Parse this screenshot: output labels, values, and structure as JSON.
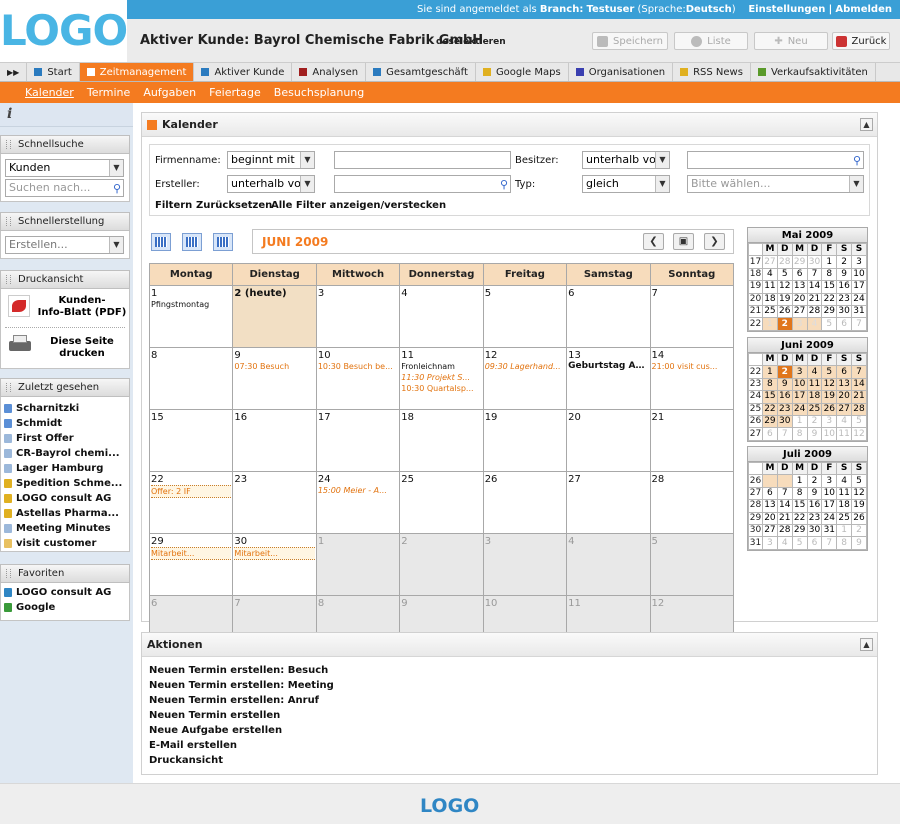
{
  "header": {
    "logo_text": "LOGO",
    "login_prefix": "Sie sind angemeldet als",
    "branch_label": "Branch:",
    "user": "Testuser",
    "lang_prefix": "(Sprache:",
    "lang": "Deutsch",
    "lang_suffix": ")",
    "settings": "Einstellungen",
    "separator": "|",
    "logout": "Abmelden",
    "customer_title": "Aktiver Kunde: Bayrol Chemische Fabrik GmbH",
    "deselect": "deselektieren",
    "buttons": {
      "save": "Speichern",
      "list": "Liste",
      "new": "Neu",
      "back": "Zurück"
    }
  },
  "nav": {
    "expand": "▶▶",
    "items": [
      {
        "label": "Start",
        "color": "#2b7bbf"
      },
      {
        "label": "Zeitmanagement",
        "color": "#ffffff"
      },
      {
        "label": "Aktiver Kunde",
        "color": "#2b7bbf"
      },
      {
        "label": "Analysen",
        "color": "#a01e1e"
      },
      {
        "label": "Gesamtgeschäft",
        "color": "#2b7bbf"
      },
      {
        "label": "Google Maps",
        "color": "#e0b020"
      },
      {
        "label": "Organisationen",
        "color": "#3a3fb0"
      },
      {
        "label": "RSS News",
        "color": "#e0b020"
      },
      {
        "label": "Verkaufsaktivitäten",
        "color": "#5a9a2a"
      }
    ],
    "active_index": 1
  },
  "subnav": [
    "Kalender",
    "Termine",
    "Aufgaben",
    "Feiertage",
    "Besuchsplanung"
  ],
  "sidebar": {
    "info_icon": "i",
    "quicksearch": {
      "title": "Schnellsuche",
      "select_value": "Kunden",
      "placeholder": "Suchen nach..."
    },
    "quickcreate": {
      "title": "Schnellerstellung",
      "select_value": "Erstellen..."
    },
    "print": {
      "title": "Druckansicht",
      "pdf_label_1": "Kunden-",
      "pdf_label_2": "Info-Blatt (PDF)",
      "print_label_1": "Diese Seite",
      "print_label_2": "drucken"
    },
    "recent": {
      "title": "Zuletzt gesehen",
      "items": [
        {
          "label": "Scharnitzki",
          "color": "#5b8fd6"
        },
        {
          "label": "Schmidt",
          "color": "#5b8fd6"
        },
        {
          "label": "First Offer",
          "color": "#9cb8da"
        },
        {
          "label": "CR-Bayrol chemi...",
          "color": "#9cb8da"
        },
        {
          "label": "Lager Hamburg",
          "color": "#9cb8da"
        },
        {
          "label": "Spedition Schme...",
          "color": "#e0b020"
        },
        {
          "label": "LOGO consult AG",
          "color": "#e0b020"
        },
        {
          "label": "Astellas Pharma...",
          "color": "#e0b020"
        },
        {
          "label": "Meeting Minutes",
          "color": "#9cb8da"
        },
        {
          "label": "visit customer",
          "color": "#e8c060"
        }
      ]
    },
    "favorites": {
      "title": "Favoriten",
      "items": [
        {
          "label": "LOGO consult AG",
          "color": "#2f86c4"
        },
        {
          "label": "Google",
          "color": "#3a9a3a"
        }
      ]
    }
  },
  "calendar_panel": {
    "title": "Kalender",
    "filters": {
      "firmenname_label": "Firmenname:",
      "firmenname_op": "beginnt mit",
      "besitzer_label": "Besitzer:",
      "besitzer_op": "unterhalb vor",
      "ersteller_label": "Ersteller:",
      "ersteller_op": "unterhalb vor",
      "typ_label": "Typ:",
      "typ_op": "gleich",
      "typ_placeholder": "Bitte wählen...",
      "filter_link": "Filtern",
      "reset_link": "Zurücksetzen",
      "toggle_link": "Alle Filter anzeigen/verstecken"
    },
    "month_title": "JUNI 2009",
    "weekdays": [
      "Montag",
      "Dienstag",
      "Mittwoch",
      "Donnerstag",
      "Freitag",
      "Samstag",
      "Sonntag"
    ],
    "weeks": [
      [
        {
          "d": "1",
          "events": [
            {
              "t": "Pfingstmontag",
              "c": "bl"
            }
          ]
        },
        {
          "d": "2 (heute)",
          "today": true,
          "events": []
        },
        {
          "d": "3",
          "events": []
        },
        {
          "d": "4",
          "events": []
        },
        {
          "d": "5",
          "events": []
        },
        {
          "d": "6",
          "events": []
        },
        {
          "d": "7",
          "events": []
        }
      ],
      [
        {
          "d": "8",
          "events": []
        },
        {
          "d": "9",
          "events": [
            {
              "t": "07:30 Besuch",
              "c": ""
            }
          ]
        },
        {
          "d": "10",
          "events": [
            {
              "t": "10:30 Besuch be...",
              "c": ""
            }
          ]
        },
        {
          "d": "11",
          "events": [
            {
              "t": "Fronleichnam",
              "c": "bl"
            },
            {
              "t": "11:30 Projekt S...",
              "c": "it"
            },
            {
              "t": "10:30 Quartalsp...",
              "c": ""
            }
          ]
        },
        {
          "d": "12",
          "events": [
            {
              "t": "09:30 Lagerhand...",
              "c": "it"
            }
          ]
        },
        {
          "d": "13",
          "events": [
            {
              "t": "Geburtstag AM...",
              "c": "bold"
            }
          ]
        },
        {
          "d": "14",
          "events": [
            {
              "t": "21:00 visit cus...",
              "c": ""
            }
          ]
        }
      ],
      [
        {
          "d": "15",
          "events": []
        },
        {
          "d": "16",
          "events": []
        },
        {
          "d": "17",
          "events": []
        },
        {
          "d": "18",
          "events": []
        },
        {
          "d": "19",
          "events": []
        },
        {
          "d": "20",
          "events": []
        },
        {
          "d": "21",
          "events": []
        }
      ],
      [
        {
          "d": "22",
          "events": [
            {
              "t": "Offer: 2 IF",
              "c": "dot"
            }
          ]
        },
        {
          "d": "23",
          "events": []
        },
        {
          "d": "24",
          "events": [
            {
              "t": "15:00 Meier - A...",
              "c": "it"
            }
          ]
        },
        {
          "d": "25",
          "events": []
        },
        {
          "d": "26",
          "events": []
        },
        {
          "d": "27",
          "events": []
        },
        {
          "d": "28",
          "events": []
        }
      ],
      [
        {
          "d": "29",
          "events": [
            {
              "t": "Mitarbeit...",
              "c": "dot"
            }
          ]
        },
        {
          "d": "30",
          "events": [
            {
              "t": "Mitarbeit...",
              "c": "dot"
            }
          ]
        },
        {
          "d": "1",
          "other": true,
          "events": []
        },
        {
          "d": "2",
          "other": true,
          "events": []
        },
        {
          "d": "3",
          "other": true,
          "events": []
        },
        {
          "d": "4",
          "other": true,
          "events": []
        },
        {
          "d": "5",
          "other": true,
          "events": []
        }
      ],
      [
        {
          "d": "6",
          "other": true,
          "events": []
        },
        {
          "d": "7",
          "other": true,
          "events": []
        },
        {
          "d": "8",
          "other": true,
          "events": []
        },
        {
          "d": "9",
          "other": true,
          "events": []
        },
        {
          "d": "10",
          "other": true,
          "events": []
        },
        {
          "d": "11",
          "other": true,
          "events": []
        },
        {
          "d": "12",
          "other": true,
          "events": []
        }
      ]
    ]
  },
  "mini_calendars": [
    {
      "title": "Mai 2009",
      "head": [
        "",
        "M",
        "D",
        "M",
        "D",
        "F",
        "S",
        "S"
      ],
      "rows": [
        [
          {
            "v": "17",
            "k": "wk"
          },
          {
            "v": "27",
            "k": "oth"
          },
          {
            "v": "28",
            "k": "oth"
          },
          {
            "v": "29",
            "k": "oth"
          },
          {
            "v": "30",
            "k": "oth"
          },
          {
            "v": "1",
            "k": ""
          },
          {
            "v": "2",
            "k": ""
          },
          {
            "v": "3",
            "k": ""
          }
        ],
        [
          {
            "v": "18",
            "k": "wk"
          },
          {
            "v": "4",
            "k": ""
          },
          {
            "v": "5",
            "k": ""
          },
          {
            "v": "6",
            "k": ""
          },
          {
            "v": "7",
            "k": ""
          },
          {
            "v": "8",
            "k": ""
          },
          {
            "v": "9",
            "k": ""
          },
          {
            "v": "10",
            "k": ""
          }
        ],
        [
          {
            "v": "19",
            "k": "wk"
          },
          {
            "v": "11",
            "k": ""
          },
          {
            "v": "12",
            "k": ""
          },
          {
            "v": "13",
            "k": ""
          },
          {
            "v": "14",
            "k": ""
          },
          {
            "v": "15",
            "k": ""
          },
          {
            "v": "16",
            "k": ""
          },
          {
            "v": "17",
            "k": ""
          }
        ],
        [
          {
            "v": "20",
            "k": "wk"
          },
          {
            "v": "18",
            "k": ""
          },
          {
            "v": "19",
            "k": ""
          },
          {
            "v": "20",
            "k": ""
          },
          {
            "v": "21",
            "k": ""
          },
          {
            "v": "22",
            "k": ""
          },
          {
            "v": "23",
            "k": ""
          },
          {
            "v": "24",
            "k": ""
          }
        ],
        [
          {
            "v": "21",
            "k": "wk"
          },
          {
            "v": "25",
            "k": ""
          },
          {
            "v": "26",
            "k": ""
          },
          {
            "v": "27",
            "k": ""
          },
          {
            "v": "28",
            "k": ""
          },
          {
            "v": "29",
            "k": ""
          },
          {
            "v": "30",
            "k": ""
          },
          {
            "v": "31",
            "k": ""
          }
        ],
        [
          {
            "v": "22",
            "k": "wk"
          },
          {
            "v": "1",
            "k": "hl"
          },
          {
            "v": "2",
            "k": "tdy"
          },
          {
            "v": "3",
            "k": "hl"
          },
          {
            "v": "4",
            "k": "hl"
          },
          {
            "v": "5",
            "k": "oth"
          },
          {
            "v": "6",
            "k": "oth"
          },
          {
            "v": "7",
            "k": "oth"
          }
        ]
      ]
    },
    {
      "title": "Juni 2009",
      "head": [
        "",
        "M",
        "D",
        "M",
        "D",
        "F",
        "S",
        "S"
      ],
      "rows": [
        [
          {
            "v": "22",
            "k": "wk"
          },
          {
            "v": "1",
            "k": "cur"
          },
          {
            "v": "2",
            "k": "tdy"
          },
          {
            "v": "3",
            "k": "cur"
          },
          {
            "v": "4",
            "k": "cur"
          },
          {
            "v": "5",
            "k": "cur"
          },
          {
            "v": "6",
            "k": "cur"
          },
          {
            "v": "7",
            "k": "cur"
          }
        ],
        [
          {
            "v": "23",
            "k": "wk"
          },
          {
            "v": "8",
            "k": "cur"
          },
          {
            "v": "9",
            "k": "cur"
          },
          {
            "v": "10",
            "k": "cur"
          },
          {
            "v": "11",
            "k": "cur"
          },
          {
            "v": "12",
            "k": "cur"
          },
          {
            "v": "13",
            "k": "cur"
          },
          {
            "v": "14",
            "k": "cur"
          }
        ],
        [
          {
            "v": "24",
            "k": "wk"
          },
          {
            "v": "15",
            "k": "cur"
          },
          {
            "v": "16",
            "k": "cur"
          },
          {
            "v": "17",
            "k": "cur"
          },
          {
            "v": "18",
            "k": "cur"
          },
          {
            "v": "19",
            "k": "cur"
          },
          {
            "v": "20",
            "k": "cur"
          },
          {
            "v": "21",
            "k": "cur"
          }
        ],
        [
          {
            "v": "25",
            "k": "wk"
          },
          {
            "v": "22",
            "k": "cur"
          },
          {
            "v": "23",
            "k": "cur"
          },
          {
            "v": "24",
            "k": "cur"
          },
          {
            "v": "25",
            "k": "cur"
          },
          {
            "v": "26",
            "k": "cur"
          },
          {
            "v": "27",
            "k": "cur"
          },
          {
            "v": "28",
            "k": "cur"
          }
        ],
        [
          {
            "v": "26",
            "k": "wk"
          },
          {
            "v": "29",
            "k": "cur"
          },
          {
            "v": "30",
            "k": "cur"
          },
          {
            "v": "1",
            "k": "oth"
          },
          {
            "v": "2",
            "k": "oth"
          },
          {
            "v": "3",
            "k": "oth"
          },
          {
            "v": "4",
            "k": "oth"
          },
          {
            "v": "5",
            "k": "oth"
          }
        ],
        [
          {
            "v": "27",
            "k": "wk"
          },
          {
            "v": "6",
            "k": "oth"
          },
          {
            "v": "7",
            "k": "oth"
          },
          {
            "v": "8",
            "k": "oth"
          },
          {
            "v": "9",
            "k": "oth"
          },
          {
            "v": "10",
            "k": "oth"
          },
          {
            "v": "11",
            "k": "oth"
          },
          {
            "v": "12",
            "k": "oth"
          }
        ]
      ]
    },
    {
      "title": "Juli 2009",
      "head": [
        "",
        "M",
        "D",
        "M",
        "D",
        "F",
        "S",
        "S"
      ],
      "rows": [
        [
          {
            "v": "26",
            "k": "wk"
          },
          {
            "v": "",
            "k": "hl"
          },
          {
            "v": "",
            "k": "hl"
          },
          {
            "v": "1",
            "k": ""
          },
          {
            "v": "2",
            "k": ""
          },
          {
            "v": "3",
            "k": ""
          },
          {
            "v": "4",
            "k": ""
          },
          {
            "v": "5",
            "k": ""
          }
        ],
        [
          {
            "v": "27",
            "k": "wk"
          },
          {
            "v": "6",
            "k": ""
          },
          {
            "v": "7",
            "k": ""
          },
          {
            "v": "8",
            "k": ""
          },
          {
            "v": "9",
            "k": ""
          },
          {
            "v": "10",
            "k": ""
          },
          {
            "v": "11",
            "k": ""
          },
          {
            "v": "12",
            "k": ""
          }
        ],
        [
          {
            "v": "28",
            "k": "wk"
          },
          {
            "v": "13",
            "k": ""
          },
          {
            "v": "14",
            "k": ""
          },
          {
            "v": "15",
            "k": ""
          },
          {
            "v": "16",
            "k": ""
          },
          {
            "v": "17",
            "k": ""
          },
          {
            "v": "18",
            "k": ""
          },
          {
            "v": "19",
            "k": ""
          }
        ],
        [
          {
            "v": "29",
            "k": "wk"
          },
          {
            "v": "20",
            "k": ""
          },
          {
            "v": "21",
            "k": ""
          },
          {
            "v": "22",
            "k": ""
          },
          {
            "v": "23",
            "k": ""
          },
          {
            "v": "24",
            "k": ""
          },
          {
            "v": "25",
            "k": ""
          },
          {
            "v": "26",
            "k": ""
          }
        ],
        [
          {
            "v": "30",
            "k": "wk"
          },
          {
            "v": "27",
            "k": ""
          },
          {
            "v": "28",
            "k": ""
          },
          {
            "v": "29",
            "k": ""
          },
          {
            "v": "30",
            "k": ""
          },
          {
            "v": "31",
            "k": ""
          },
          {
            "v": "1",
            "k": "oth"
          },
          {
            "v": "2",
            "k": "oth"
          }
        ],
        [
          {
            "v": "31",
            "k": "wk"
          },
          {
            "v": "3",
            "k": "oth"
          },
          {
            "v": "4",
            "k": "oth"
          },
          {
            "v": "5",
            "k": "oth"
          },
          {
            "v": "6",
            "k": "oth"
          },
          {
            "v": "7",
            "k": "oth"
          },
          {
            "v": "8",
            "k": "oth"
          },
          {
            "v": "9",
            "k": "oth"
          }
        ]
      ]
    }
  ],
  "actions": {
    "title": "Aktionen",
    "items": [
      "Neuen Termin erstellen: Besuch",
      "Neuen Termin erstellen: Meeting",
      "Neuen Termin erstellen: Anruf",
      "Neuen Termin erstellen",
      "Neue Aufgabe erstellen",
      "E-Mail erstellen",
      "Druckansicht"
    ]
  },
  "footer": {
    "logo_text": "LOGO"
  },
  "colors": {
    "accent": "#f47b20",
    "topbar": "#3a9fd6",
    "logo": "#49b5e4",
    "event": "#e2730f",
    "today_bg": "#f2dfc4"
  }
}
